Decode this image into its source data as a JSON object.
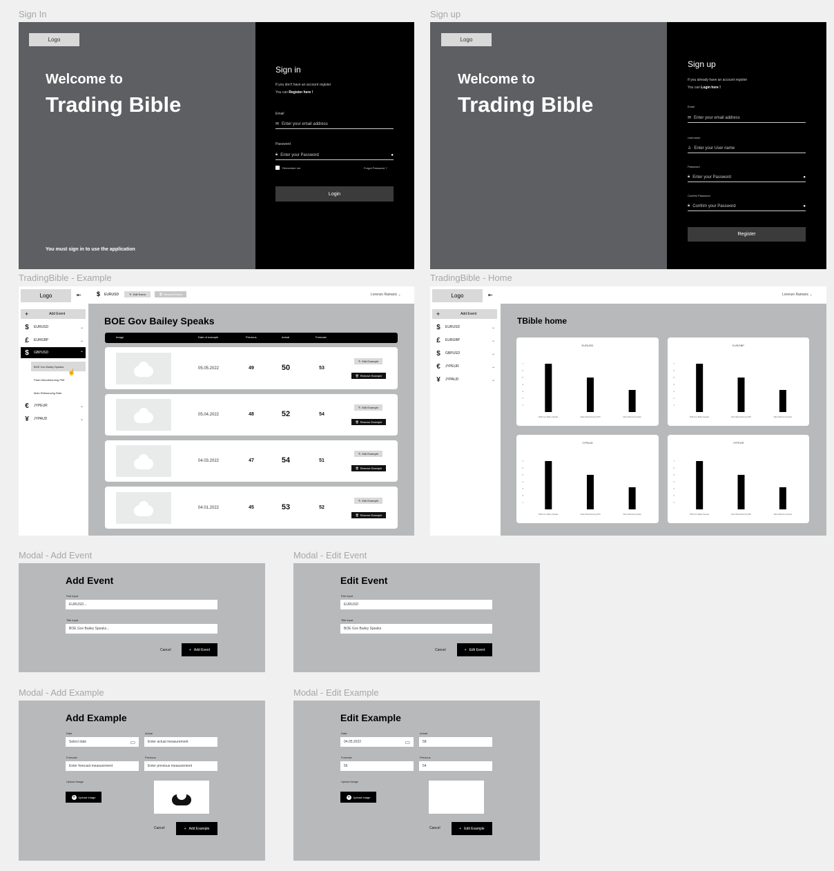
{
  "frames": {
    "sign_in": "Sign In",
    "sign_up": "Sign up",
    "example": "TradingBible - Example",
    "home": "TradingBible - Home",
    "modal_add_event": "Modal - Add Event",
    "modal_edit_event": "Modal - Edit Event",
    "modal_add_example": "Modal - Add Example",
    "modal_edit_example": "Modal - Edit Example"
  },
  "sign_in": {
    "logo": "Logo",
    "welcome": "Welcome to",
    "brand": "Trading Bible",
    "footer": "You must sign in to use the application",
    "title": "Sign in",
    "info1": "If you don't have an account register",
    "info2_prefix": "You can",
    "info2_link": "Register here !",
    "email_label": "Email",
    "email_placeholder": "Enter your email address",
    "password_label": "Password",
    "password_placeholder": "Enter your Password",
    "remember": "Remember me",
    "forgot": "Forgot Password ?",
    "login_button": "Login"
  },
  "sign_up": {
    "logo": "Logo",
    "welcome": "Welcome to",
    "brand": "Trading Bible",
    "title": "Sign up",
    "info1": "If you already have an account register",
    "info2_prefix": "You can",
    "info2_link": "Login here !",
    "email_label": "Email",
    "email_placeholder": "Enter your email address",
    "username_label": "Username",
    "username_placeholder": "Enter your User name",
    "password_label": "Password",
    "password_placeholder": "Enter your Password",
    "confirm_label": "Confrim Password",
    "confirm_placeholder": "Confrim your Password",
    "register_button": "Register"
  },
  "sidebar": {
    "logo": "Logo",
    "collapse_icon": "collapse-icon",
    "add_event": "Add Event",
    "pairs": [
      {
        "symbol": "$",
        "label": "EURUSD"
      },
      {
        "symbol": "£",
        "label": "EURGBP"
      },
      {
        "symbol": "$",
        "label": "GBPUSD"
      },
      {
        "symbol": "€",
        "label": "JYPEUR"
      },
      {
        "symbol": "¥",
        "label": "JYPAUD"
      }
    ],
    "sub_events": [
      "BOE Gov Bailey Speaks",
      "Flash Manufacturing PMI",
      "Main Refinancing Rate"
    ]
  },
  "example": {
    "top_pair": "EURUSD",
    "edit_event": "Edit Event",
    "remove_event": "Remove Event",
    "user": "Lorenzo Ramaric",
    "title": "BOE Gov Bailey Speaks",
    "headers": [
      "Image",
      "Date of example",
      "Previous",
      "Actual",
      "Forecast"
    ],
    "rows": [
      {
        "date": "05.05.2022",
        "previous": "49",
        "actual": "50",
        "forecast": "53"
      },
      {
        "date": "05.04.2022",
        "previous": "48",
        "actual": "52",
        "forecast": "54"
      },
      {
        "date": "04.03.2022",
        "previous": "47",
        "actual": "54",
        "forecast": "51"
      },
      {
        "date": "04.01.2022",
        "previous": "45",
        "actual": "53",
        "forecast": "52"
      }
    ],
    "edit_example": "Edit Example",
    "remove_example": "Remove Example"
  },
  "home": {
    "user": "Lorenzo Ramaric",
    "title": "TBible home"
  },
  "chart_data": [
    {
      "type": "bar",
      "title": "EURUSD",
      "categories": [
        "BOE Gov Bailey Speaks",
        "Flash Manufacturing PMI",
        "Main Refinancing Rate"
      ],
      "values": [
        7,
        5,
        3.2
      ],
      "ylim": [
        0,
        8
      ]
    },
    {
      "type": "bar",
      "title": "EURGBP",
      "categories": [
        "BOE Gov Bailey Speaks",
        "Flash Manufacturing PMI",
        "Main Refinancing Rate"
      ],
      "values": [
        7,
        5,
        3.2
      ],
      "ylim": [
        0,
        8
      ]
    },
    {
      "type": "bar",
      "title": "JYPAUD",
      "categories": [
        "BOE Gov Bailey Speaks",
        "Flash Manufacturing PMI",
        "Main Refinancing Rate"
      ],
      "values": [
        7,
        5,
        3.2
      ],
      "ylim": [
        0,
        8
      ]
    },
    {
      "type": "bar",
      "title": "JYPEUR",
      "categories": [
        "BOE Gov Bailey Speaks",
        "Flash Manufacturing PMI",
        "Main Refinancing Rate"
      ],
      "values": [
        7,
        5,
        3.2
      ],
      "ylim": [
        0,
        8
      ]
    }
  ],
  "modal_add_event": {
    "title": "Add Event",
    "pair_label": "Pair Input",
    "pair_value": "EURUSD...",
    "title_label": "Title input",
    "title_value": "BOE Gov Bailey Speaks...",
    "cancel": "Cancel",
    "submit": "Add Event"
  },
  "modal_edit_event": {
    "title": "Edit Event",
    "pair_label": "Pair Input",
    "pair_value": "EURUSD",
    "title_label": "Title input",
    "title_value": "BOE Gov Bailey Speaks",
    "cancel": "Cancel",
    "submit": "Edit Event"
  },
  "modal_add_example": {
    "title": "Add Example",
    "date_label": "Date",
    "date_value": "Select date",
    "actual_label": "Actual",
    "actual_value": "Enter actual measurement",
    "forecast_label": "Forecast",
    "forecast_value": "Enter forecast measurement",
    "previous_label": "Previous",
    "previous_value": "Enter previous measurement",
    "upload_label": "Upload Image",
    "upload_button": "Upload Image",
    "cancel": "Cancel",
    "submit": "Add Example"
  },
  "modal_edit_example": {
    "title": "Edit Example",
    "date_label": "Date",
    "date_value": "04.05.2022",
    "actual_label": "Actual",
    "actual_value": "58",
    "forecast_label": "Forecast",
    "forecast_value": "56",
    "previous_label": "Previous",
    "previous_value": "54",
    "upload_label": "Upload Image",
    "upload_button": "Upload Image",
    "cancel": "Cancel",
    "submit": "Edit Example"
  }
}
